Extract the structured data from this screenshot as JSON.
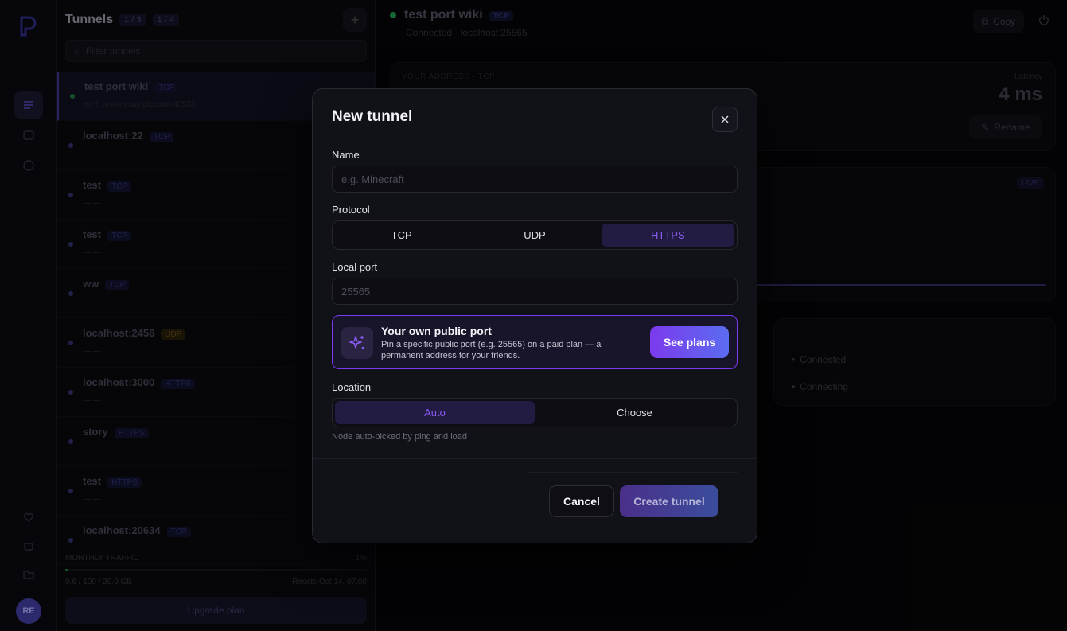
{
  "rail": {
    "avatar_initials": "RE"
  },
  "tunnels_panel": {
    "title": "Tunnels",
    "count_chip": "1 / 3",
    "nodes_chip": "1 / 4",
    "filter_placeholder": "Filter tunnels",
    "items": [
      {
        "name": "test port wiki",
        "protocol": "TCP",
        "sub": "eu-fr.proxy.example.com:40533",
        "status": "connected"
      },
      {
        "name": "localhost:22",
        "protocol": "TCP",
        "sub": "— —",
        "status": "idle"
      },
      {
        "name": "test",
        "protocol": "TCP",
        "sub": "— —",
        "status": "idle"
      },
      {
        "name": "test",
        "protocol": "TCP",
        "sub": "— —",
        "status": "idle"
      },
      {
        "name": "ww",
        "protocol": "TCP",
        "sub": "— —",
        "status": "idle"
      },
      {
        "name": "localhost:2456",
        "protocol": "UDP",
        "sub": "— —",
        "status": "idle"
      },
      {
        "name": "localhost:3000",
        "protocol": "HTTPS",
        "sub": "— —",
        "status": "idle"
      },
      {
        "name": "story",
        "protocol": "HTTPS",
        "sub": "— —",
        "status": "idle"
      },
      {
        "name": "test",
        "protocol": "HTTPS",
        "sub": "— —",
        "status": "idle"
      },
      {
        "name": "localhost:20634",
        "protocol": "TCP",
        "sub": "",
        "status": "idle"
      }
    ],
    "traffic_label": "MONTHLY TRAFFIC",
    "traffic_percent_label": "1%",
    "traffic_used": 0.01,
    "traffic_detail": "0.6 / 100 / 20.0 GB",
    "traffic_reset": "Resets Oct 14, 07:00",
    "upgrade_label": "Upgrade plan"
  },
  "main": {
    "title": "test port wiki",
    "protocol": "TCP",
    "subtitle": "Connected · localhost:25565",
    "copy_label": "Copy",
    "address_label": "YOUR ADDRESS · TCP",
    "latency_label": "Latency",
    "latency_value": "4 ms",
    "rename_label": "Rename",
    "live_label": "LIVE",
    "events": [
      "Connected",
      "Connecting"
    ]
  },
  "modal": {
    "title": "New tunnel",
    "name_label": "Name",
    "name_placeholder": "e.g. Minecraft",
    "protocol_label": "Protocol",
    "protocol_options": [
      "TCP",
      "UDP",
      "HTTPS"
    ],
    "protocol_selected": "HTTPS",
    "port_label": "Local port",
    "port_placeholder": "25565",
    "promo_title": "Your own public port",
    "promo_desc": "Pin a specific public port (e.g. 25565) on a paid plan — a permanent address for your friends.",
    "promo_button": "See plans",
    "location_label": "Location",
    "location_options": [
      "Auto",
      "Choose"
    ],
    "location_selected": "Auto",
    "location_hint": "Node auto-picked by ping and load",
    "cancel_label": "Cancel",
    "create_label": "Create tunnel"
  },
  "colors": {
    "accent": "#8b5cf6",
    "promo_border": "#7c3aed",
    "modal_bg": "#111118",
    "connected": "#1d8a49"
  }
}
